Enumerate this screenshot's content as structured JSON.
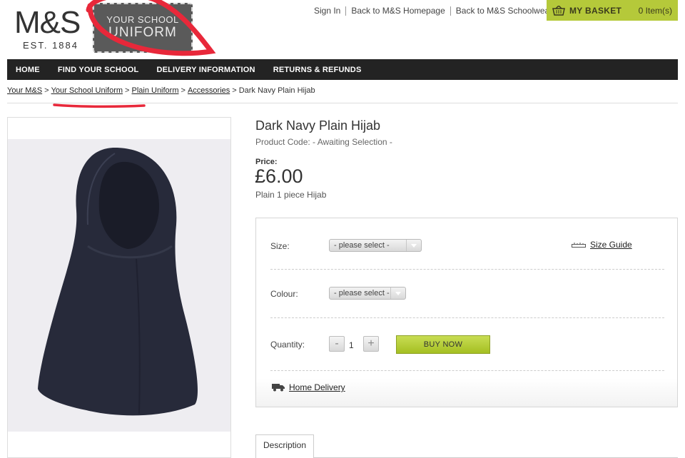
{
  "brand": {
    "logo_text": "M&S",
    "est": "EST. 1884",
    "school_badge_line1": "YOUR SCHOOL",
    "school_badge_line2": "UNIFORM"
  },
  "top_links": [
    "Sign In",
    "Back to M&S Homepage",
    "Back to M&S Schoolwear"
  ],
  "basket": {
    "title": "MY BASKET",
    "count": "0 Item(s)"
  },
  "nav": [
    "HOME",
    "FIND YOUR SCHOOL",
    "DELIVERY INFORMATION",
    "RETURNS & REFUNDS"
  ],
  "breadcrumb": [
    "Your M&S",
    "Your School Uniform",
    "Plain Uniform",
    "Accessories",
    "Dark Navy Plain Hijab"
  ],
  "product": {
    "title": "Dark Navy Plain Hijab",
    "code": "Product Code: - Awaiting Selection -",
    "price_label": "Price:",
    "price": "£6.00",
    "description": "Plain 1 piece Hijab"
  },
  "options": {
    "size_label": "Size:",
    "size_placeholder": "- please select -",
    "size_guide": "Size Guide",
    "colour_label": "Colour:",
    "colour_placeholder": "- please select -",
    "quantity_label": "Quantity:",
    "quantity_minus": "-",
    "quantity_value": "1",
    "quantity_plus": "+",
    "buy_button": "BUY NOW",
    "delivery": "Home Delivery"
  },
  "tabs": [
    "Description"
  ],
  "colors": {
    "nav_bg": "#232323",
    "basket_bg": "#b5c93a",
    "buy_button": "#b9d03b",
    "annotation_red": "#e8283a"
  }
}
